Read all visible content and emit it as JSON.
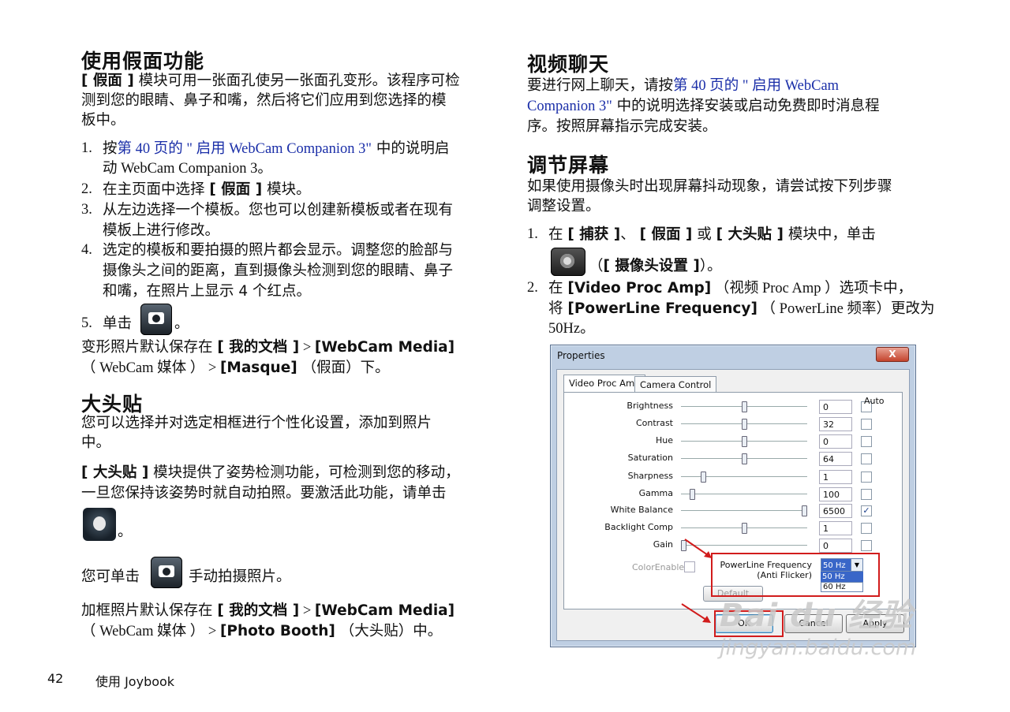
{
  "left": {
    "s1_title": "使用假面功能",
    "s1_intro_a": "[ 假面 ]",
    "s1_intro_b": " 模块可用一张面孔使另一张面孔变形。该程序可检",
    "s1_intro_2": "测到您的眼睛、鼻子和嘴，然后将它们应用到您选择的模",
    "s1_intro_3": "板中。",
    "steps": [
      {
        "num": "1.",
        "pre": "按",
        "link": "第 40 页的 \" 启用 WebCam Companion 3\"",
        "post": " 中的说明启",
        "line2": "动 WebCam Companion 3。"
      },
      {
        "num": "2.",
        "pre": "在主页面中选择 ",
        "bold": "[ 假面 ]",
        "post": " 模块。"
      },
      {
        "num": "3.",
        "line1": "从左边选择一个模板。您也可以创建新模板或者在现有",
        "line2": "模板上进行修改。"
      },
      {
        "num": "4.",
        "line1": "选定的模板和要拍摄的照片都会显示。调整您的脸部与",
        "line2": "摄像头之间的距离，直到摄像头检测到您的眼睛、鼻子",
        "line3": "和嘴，在照片上显示 4 个红点。"
      },
      {
        "num": "5.",
        "pre": "单击",
        "post": "。"
      }
    ],
    "save1_a": "变形照片默认保存在 ",
    "save1_b": "[ 我的文档 ]",
    "save1_c": " > ",
    "save1_d": "[WebCam Media]",
    "save1_e": "（ WebCam 媒体 ） > ",
    "save1_f": "[Masque]",
    "save1_g": " （假面）下。",
    "s2_title": "大头贴",
    "s2_p1_1": "您可以选择并对选定相框进行个性化设置，添加到照片",
    "s2_p1_2": "中。",
    "s2_p2_a": "[ 大头贴 ]",
    "s2_p2_b": " 模块提供了姿势检测功能，可检测到您的移动，",
    "s2_p2_2": "一旦您保持该姿势时就自动拍照。要激活此功能，请单击",
    "s2_p2_3": "。",
    "s2_p3_a": "您可单击",
    "s2_p3_b": "手动拍摄照片。",
    "save2_a": "加框照片默认保存在 ",
    "save2_b": "[ 我的文档 ]",
    "save2_c": " > ",
    "save2_d": "[WebCam Media]",
    "save2_e": "（ WebCam 媒体 ） > ",
    "save2_f": "[Photo Booth]",
    "save2_g": " （大头贴）中。"
  },
  "right": {
    "s3_title": "视频聊天",
    "s3_1_a": "要进行网上聊天，请按",
    "s3_1_link": "第 40 页的 \" 启用 WebCam",
    "s3_2_link": "Companion 3\"",
    "s3_2_b": " 中的说明选择安装或启动免费即时消息程",
    "s3_3": "序。按照屏幕指示完成安装。",
    "s4_title": "调节屏幕",
    "s4_1": "如果使用摄像头时出现屏幕抖动现象，请尝试按下列步骤",
    "s4_2": "调整设置。",
    "st1_num": "1.",
    "st1_a": "在 ",
    "st1_b": "[ 捕获 ]",
    "st1_c": "、 ",
    "st1_d": "[ 假面 ]",
    "st1_e": " 或 ",
    "st1_f": "[ 大头贴 ]",
    "st1_g": " 模块中，单击",
    "st1_h": "（",
    "st1_i": "[ 摄像头设置 ]",
    "st1_j": "）。",
    "st2_num": "2.",
    "st2_a": "在 ",
    "st2_b": "[Video Proc Amp]",
    "st2_c": " （视频 Proc Amp ）选项卡中，",
    "st2_d": "将 ",
    "st2_e": "[PowerLine Frequency]",
    "st2_f": " （ PowerLine 频率）更改为",
    "st2_g": "50Hz。"
  },
  "dialog": {
    "title": "Properties",
    "close": "X",
    "tab1": "Video Proc Amp",
    "tab2": "Camera Control",
    "auto": "Auto",
    "rows": [
      {
        "label": "Brightness",
        "value": "0",
        "level": 0.5,
        "auto": ""
      },
      {
        "label": "Contrast",
        "value": "32",
        "level": 0.5,
        "auto": ""
      },
      {
        "label": "Hue",
        "value": "0",
        "level": 0.5,
        "auto": ""
      },
      {
        "label": "Saturation",
        "value": "64",
        "level": 0.5,
        "auto": ""
      },
      {
        "label": "Sharpness",
        "value": "1",
        "level": 0.17,
        "auto": ""
      },
      {
        "label": "Gamma",
        "value": "100",
        "level": 0.08,
        "auto": ""
      },
      {
        "label": "White Balance",
        "value": "6500",
        "level": 0.98,
        "auto": "✓"
      },
      {
        "label": "Backlight Comp",
        "value": "1",
        "level": 0.5,
        "auto": ""
      },
      {
        "label": "Gain",
        "value": "0",
        "level": 0.01,
        "auto": ""
      }
    ],
    "color_enable": "ColorEnable",
    "pl_label_1": "PowerLine Frequency",
    "pl_label_2": "(Anti Flicker)",
    "pl_selected": "50 Hz",
    "pl_opt1": "50 Hz",
    "pl_opt2": "60 Hz",
    "default": "Default",
    "ok": "OK",
    "cancel": "Cancel",
    "apply": "Apply"
  },
  "footer": {
    "page": "42",
    "title": "使用 Joybook"
  },
  "watermark": {
    "line1": "Bai du 经验",
    "line2": "jingyan.baidu.com"
  },
  "colors": {
    "link": "#1a2ea8",
    "highlight": "#d11c1c"
  }
}
